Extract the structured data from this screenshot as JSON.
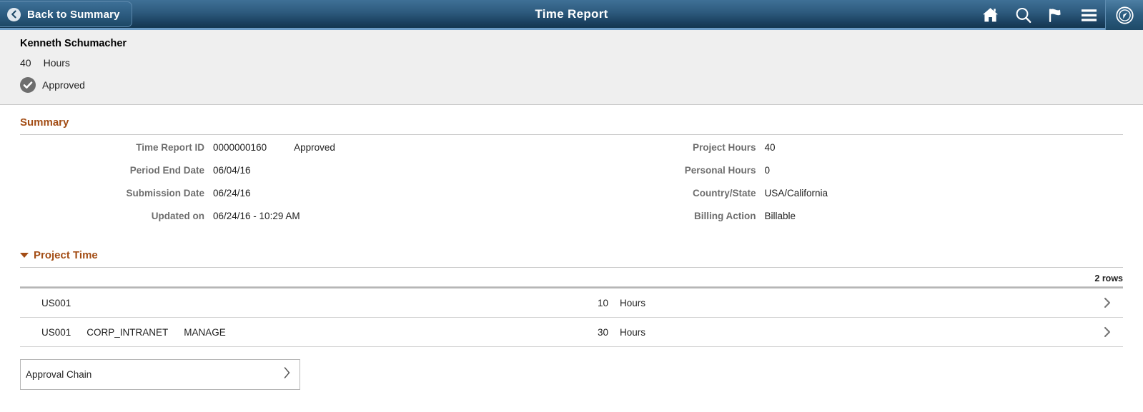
{
  "header": {
    "back_label": "Back to Summary",
    "title": "Time Report",
    "icons": [
      {
        "name": "home-icon"
      },
      {
        "name": "search-icon"
      },
      {
        "name": "flag-icon"
      },
      {
        "name": "menu-icon"
      },
      {
        "name": "navigator-icon"
      }
    ]
  },
  "employee": {
    "name": "Kenneth Schumacher",
    "hours_value": "40",
    "hours_unit": "Hours",
    "status": "Approved"
  },
  "summary": {
    "title": "Summary",
    "left_fields": [
      {
        "label": "Time Report ID",
        "value": "0000000160",
        "extra": "Approved"
      },
      {
        "label": "Period End Date",
        "value": "06/04/16",
        "extra": ""
      },
      {
        "label": "Submission Date",
        "value": "06/24/16",
        "extra": ""
      },
      {
        "label": "Updated on",
        "value": "06/24/16 - 10:29 AM",
        "extra": ""
      }
    ],
    "right_fields": [
      {
        "label": "Project Hours",
        "value": "40",
        "extra": ""
      },
      {
        "label": "Personal Hours",
        "value": "0",
        "extra": ""
      },
      {
        "label": "Country/State",
        "value": "USA/California",
        "extra": ""
      },
      {
        "label": "Billing Action",
        "value": "Billable",
        "extra": ""
      }
    ]
  },
  "project_time": {
    "title": "Project Time",
    "row_count_label": "2 rows",
    "rows": [
      {
        "codes": [
          "US001"
        ],
        "hours": "10",
        "unit": "Hours"
      },
      {
        "codes": [
          "US001",
          "CORP_INTRANET",
          "MANAGE"
        ],
        "hours": "30",
        "unit": "Hours"
      }
    ]
  },
  "approval_chain": {
    "label": "Approval Chain"
  },
  "colors": {
    "header_top": "#3f7096",
    "header_bottom": "#143750",
    "header_accent": "#6c9cc6",
    "section_heading": "#a34d15",
    "band_background": "#efefef",
    "status_badge": "#6e6e6e",
    "label_text": "#6e6e6e"
  }
}
